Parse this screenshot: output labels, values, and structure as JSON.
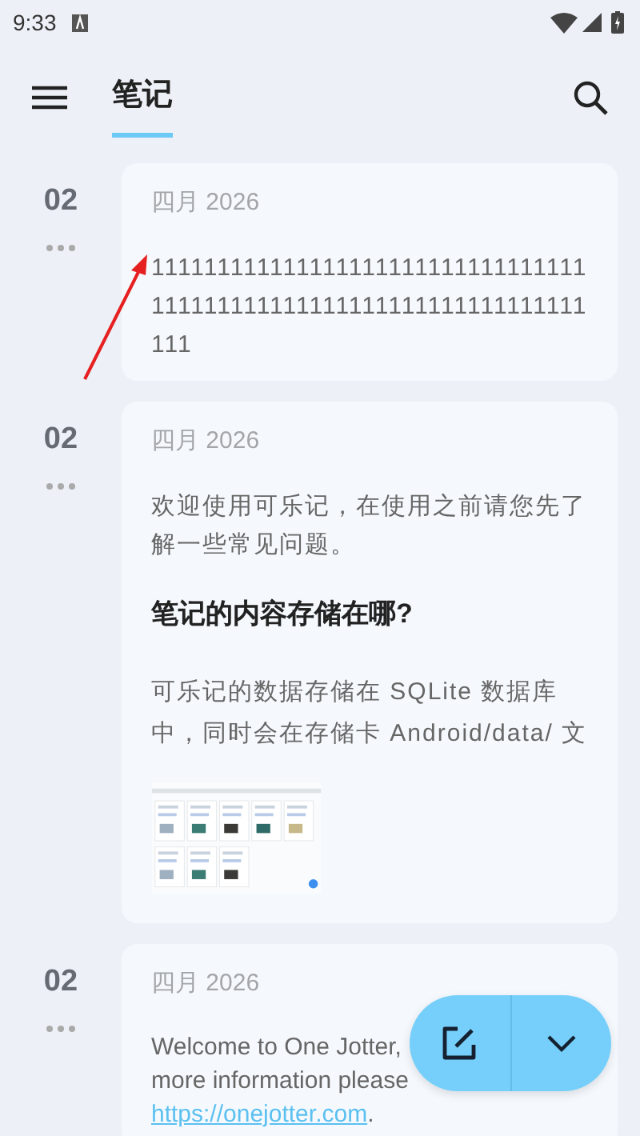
{
  "status_bar": {
    "time": "9:33"
  },
  "app_bar": {
    "tabs": [
      {
        "label": "笔记",
        "selected": true
      }
    ]
  },
  "notes": [
    {
      "day": "02",
      "date": "四月 2026",
      "blocks": [
        {
          "kind": "paragraph",
          "text": "111111111111111111111111111111111111111111111111111111111111111111111"
        }
      ]
    },
    {
      "day": "02",
      "date": "四月 2026",
      "blocks": [
        {
          "kind": "paragraph",
          "text": "欢迎使用可乐记，在使用之前请您先了解一些常见问题。"
        },
        {
          "kind": "heading",
          "text": "笔记的内容存储在哪?"
        },
        {
          "kind": "paragraph",
          "text": "可乐记的数据存储在 SQLite 数据库中，同时会在存储卡 Android/data/ 文"
        },
        {
          "kind": "image"
        }
      ]
    },
    {
      "day": "02",
      "date": "四月 2026",
      "blocks": [
        {
          "kind": "line",
          "text": "Welcome to One Jotter,"
        },
        {
          "kind": "line",
          "text": "more information please"
        },
        {
          "kind": "link",
          "text": "https://onejotter.com",
          "trail": "."
        }
      ]
    }
  ]
}
